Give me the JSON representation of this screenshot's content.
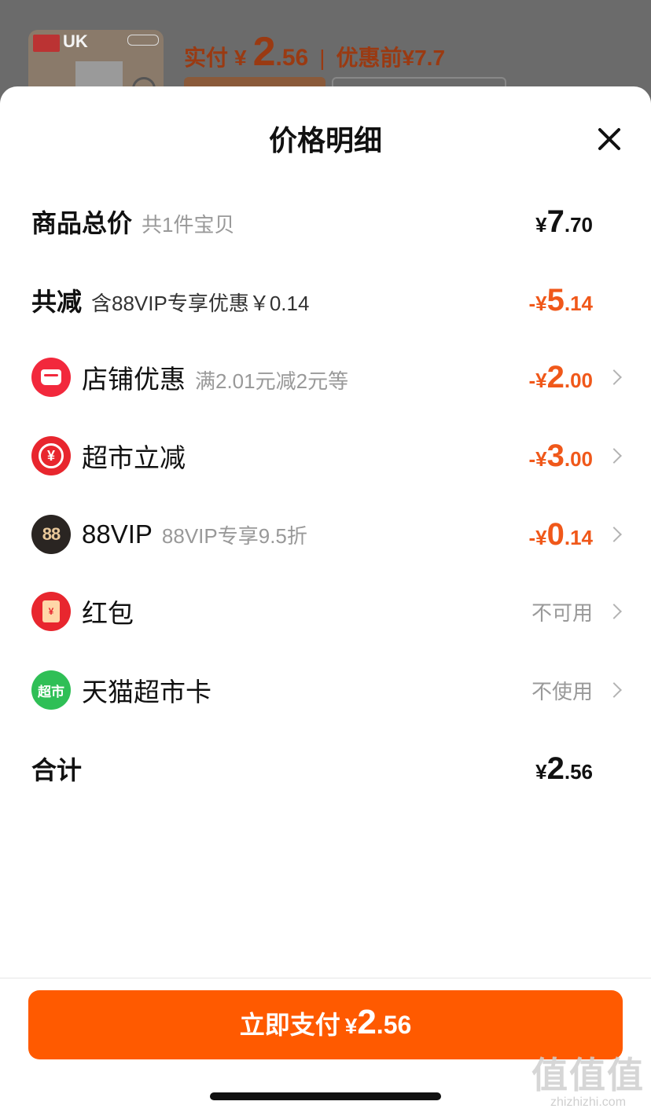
{
  "backdrop": {
    "thumb_text": "UK",
    "paid_label": "实付",
    "paid_yen": "¥",
    "paid_int": "2",
    "paid_dec": ".56",
    "separator": "|",
    "original": "优惠前¥7.7"
  },
  "sheet": {
    "title": "价格明细"
  },
  "rows": {
    "total": {
      "label": "商品总价",
      "sub": "共1件宝贝",
      "yen": "¥",
      "int": "7",
      "dec": ".70"
    },
    "discount": {
      "label": "共减",
      "sub": "含88VIP专享优惠￥0.14",
      "yen": "-¥",
      "int": "5",
      "dec": ".14"
    },
    "shop": {
      "label": "店铺优惠",
      "sub": "满2.01元减2元等",
      "yen": "-¥",
      "int": "2",
      "dec": ".00"
    },
    "market": {
      "label": "超市立减",
      "icon_glyph": "¥",
      "yen": "-¥",
      "int": "3",
      "dec": ".00"
    },
    "vip": {
      "label": "88VIP",
      "icon_glyph": "88",
      "sub": "88VIP专享9.5折",
      "yen": "-¥",
      "int": "0",
      "dec": ".14"
    },
    "redpacket": {
      "label": "红包",
      "icon_glyph": "¥",
      "status": "不可用"
    },
    "card": {
      "label": "天猫超市卡",
      "icon_glyph": "超市",
      "status": "不使用"
    },
    "sum": {
      "label": "合计",
      "yen": "¥",
      "int": "2",
      "dec": ".56"
    }
  },
  "pay_button": {
    "label": "立即支付",
    "yen": "¥",
    "int": "2",
    "dec": ".56"
  },
  "watermark": {
    "big": "值值值",
    "small": "zhizhizhi.com"
  },
  "colors": {
    "accent": "#ff5a00",
    "discount_text": "#f0581a",
    "muted": "#999999"
  }
}
